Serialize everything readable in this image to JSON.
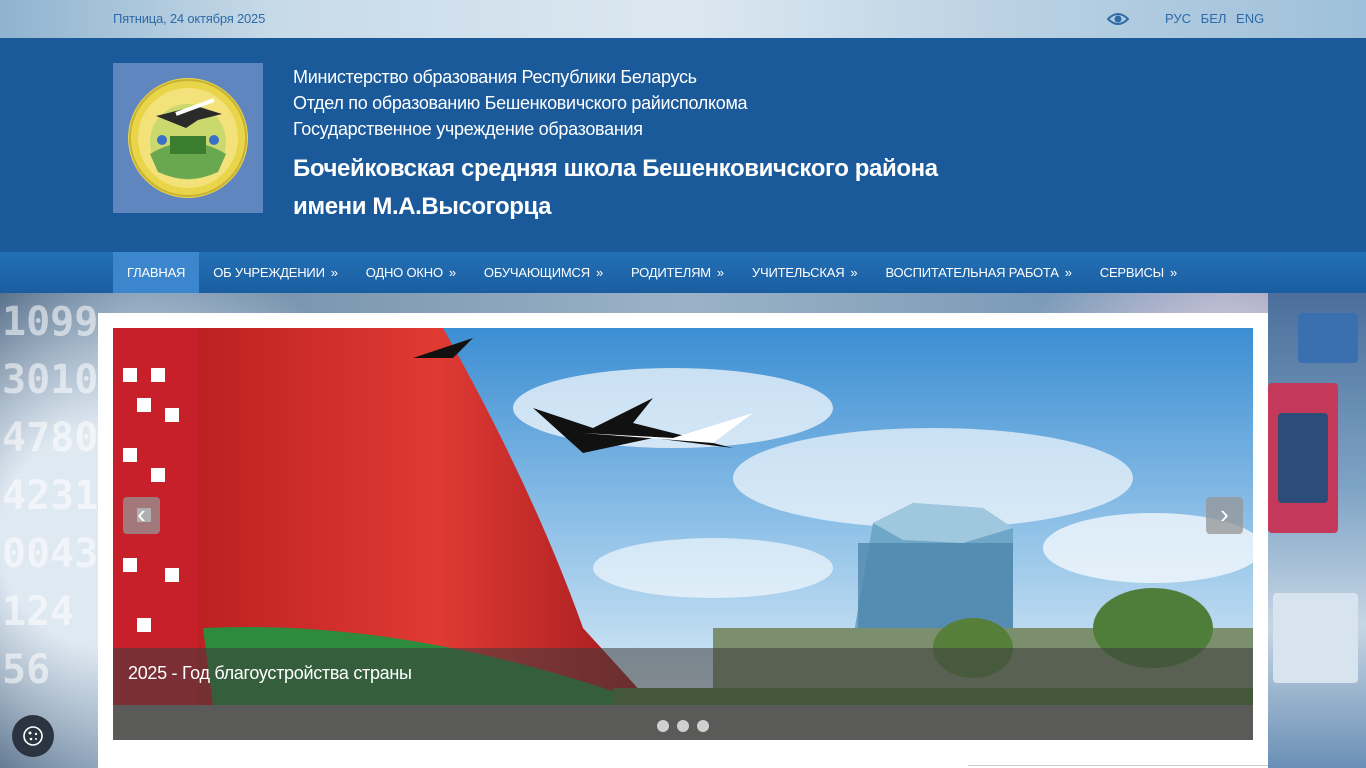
{
  "topbar": {
    "date": "Пятница, 24 октября 2025",
    "accessibility_icon": "eye-icon",
    "languages": [
      "РУС",
      "БЕЛ",
      "ENG"
    ]
  },
  "header": {
    "lines": [
      "Министерство образования Республики Беларусь",
      "Отдел по образованию Бешенковичского райисполкома",
      "Государственное учреждение образования"
    ],
    "school_name": "Бочейковская средняя школа Бешенковичского района имени М.А.Высогорца",
    "logo_icon": "school-emblem-icon"
  },
  "nav": {
    "items": [
      {
        "label": "ГЛАВНАЯ",
        "has_submenu": false
      },
      {
        "label": "ОБ УЧРЕЖДЕНИИ",
        "has_submenu": true
      },
      {
        "label": "ОДНО ОКНО",
        "has_submenu": true
      },
      {
        "label": "ОБУЧАЮЩИМСЯ",
        "has_submenu": true
      },
      {
        "label": "РОДИТЕЛЯМ",
        "has_submenu": true
      },
      {
        "label": "УЧИТЕЛЬСКАЯ",
        "has_submenu": true
      },
      {
        "label": "ВОСПИТАТЕЛЬНАЯ РАБОТА",
        "has_submenu": true
      },
      {
        "label": "СЕРВИСЫ",
        "has_submenu": true
      }
    ],
    "submenu_marker": "»"
  },
  "slider": {
    "caption": "2025 - Год благоустройства страны",
    "prev_icon": "chevron-left-icon",
    "next_icon": "chevron-right-icon",
    "slide_count": 3,
    "active_index": 0
  },
  "colors": {
    "header_bg": "#1a5a9a",
    "nav_active": "#3b86cc",
    "topbar_text": "#2e6aa6"
  },
  "cookie": {
    "icon": "cookie-icon"
  }
}
